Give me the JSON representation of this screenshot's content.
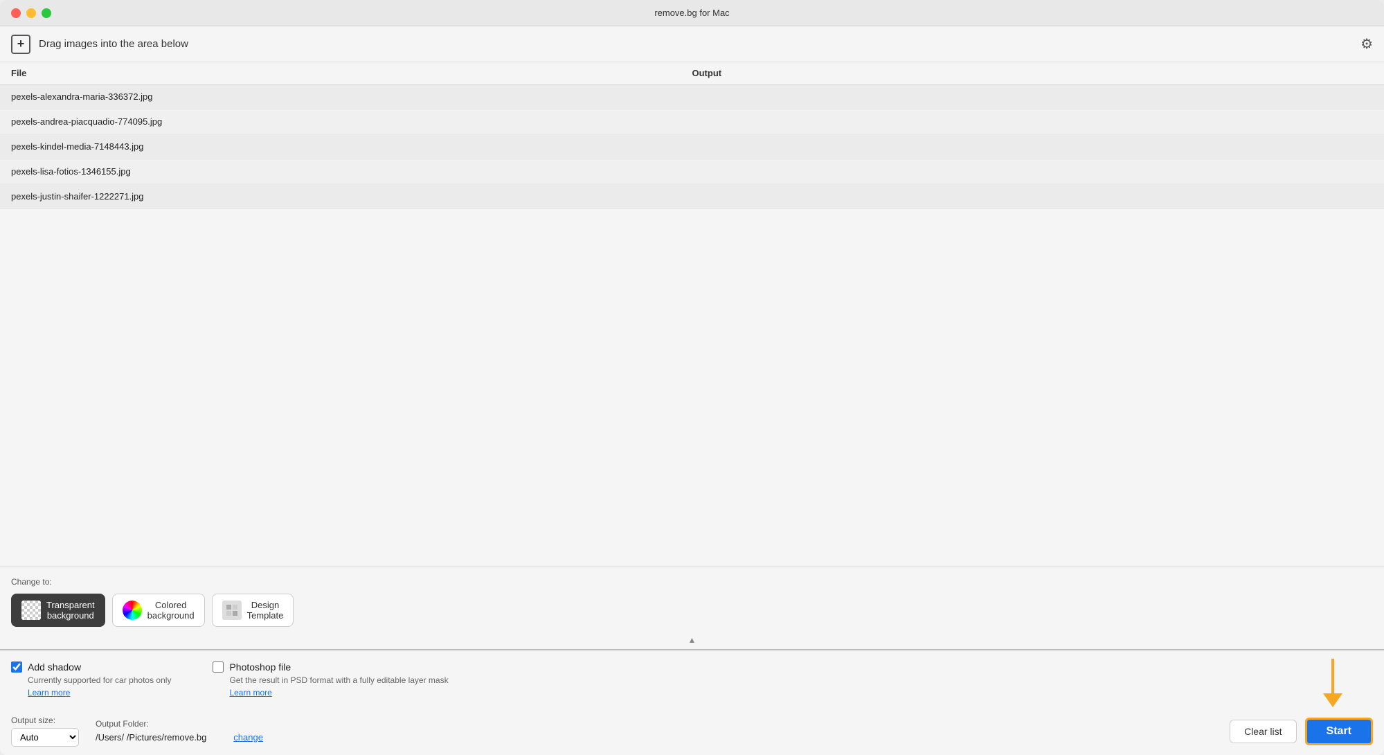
{
  "window": {
    "title": "remove.bg for Mac"
  },
  "titlebar": {
    "close_label": "",
    "min_label": "",
    "max_label": ""
  },
  "toolbar": {
    "add_label": "+",
    "drag_label": "Drag images into the area below",
    "settings_icon": "⚙"
  },
  "file_list": {
    "col_file": "File",
    "col_output": "Output",
    "files": [
      {
        "name": "pexels-alexandra-maria-336372.jpg"
      },
      {
        "name": "pexels-andrea-piacquadio-774095.jpg"
      },
      {
        "name": "pexels-kindel-media-7148443.jpg"
      },
      {
        "name": "pexels-lisa-fotios-1346155.jpg"
      },
      {
        "name": "pexels-justin-shaifer-1222271.jpg"
      }
    ]
  },
  "change_to": {
    "label": "Change to:",
    "options": [
      {
        "id": "transparent",
        "label1": "Transparent",
        "label2": "background",
        "active": true
      },
      {
        "id": "colored",
        "label1": "Colored",
        "label2": "background",
        "active": false
      },
      {
        "id": "design",
        "label1": "Design",
        "label2": "Template",
        "active": false
      }
    ]
  },
  "options": {
    "add_shadow": {
      "title": "Add shadow",
      "desc": "Currently supported for car photos only",
      "link": "Learn more",
      "checked": true
    },
    "photoshop": {
      "title": "Photoshop file",
      "desc": "Get the result in PSD format with a fully editable layer mask",
      "link": "Learn more",
      "checked": false
    }
  },
  "footer": {
    "size_label": "Output size:",
    "size_value": "Auto",
    "folder_label": "Output Folder:",
    "folder_path": "/Users/    /Pictures/remove.bg",
    "folder_change": "change",
    "clear_btn": "Clear list",
    "start_btn": "Start"
  }
}
